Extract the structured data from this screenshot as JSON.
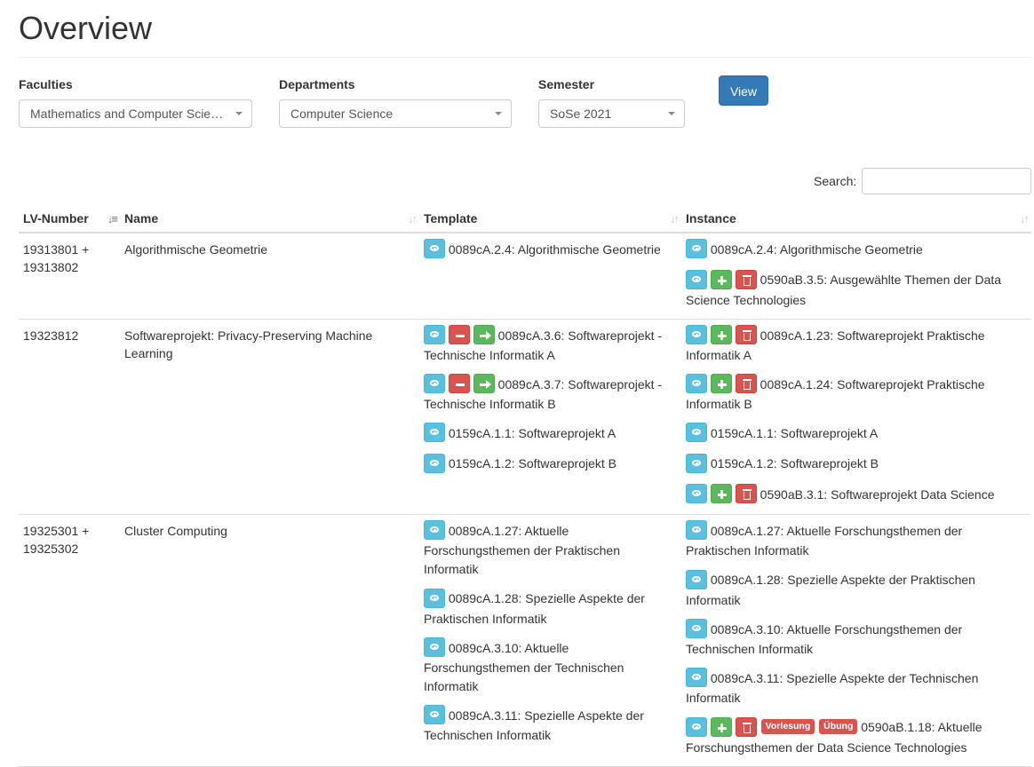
{
  "page": {
    "title": "Overview"
  },
  "filters": {
    "faculties": {
      "label": "Faculties",
      "value": "Mathematics and Computer Science"
    },
    "departments": {
      "label": "Departments",
      "value": "Computer Science"
    },
    "semester": {
      "label": "Semester",
      "value": "SoSe 2021"
    },
    "view_label": "View"
  },
  "search": {
    "label": "Search:",
    "value": ""
  },
  "table": {
    "headers": {
      "lv_number": "LV-Number",
      "name": "Name",
      "template": "Template",
      "instance": "Instance"
    },
    "rows": [
      {
        "lv": [
          "19313801 +",
          "19313802"
        ],
        "name": "Algorithmische Geometrie",
        "template": [
          {
            "buttons": [
              "view"
            ],
            "badges": [],
            "text": "0089cA.2.4: Algorithmische Geometrie"
          }
        ],
        "instance": [
          {
            "buttons": [
              "view"
            ],
            "badges": [],
            "text": "0089cA.2.4: Algorithmische Geometrie"
          },
          {
            "buttons": [
              "view",
              "add",
              "delete"
            ],
            "badges": [],
            "text": "0590aB.3.5: Ausgewählte Themen der Data Science Technologies"
          }
        ]
      },
      {
        "lv": [
          "19323812"
        ],
        "name": "Softwareprojekt: Privacy-Preserving Machine Learning",
        "template": [
          {
            "buttons": [
              "view",
              "remove",
              "forward"
            ],
            "badges": [],
            "text": "0089cA.3.6: Softwareprojekt - Technische Informatik A"
          },
          {
            "buttons": [
              "view",
              "remove",
              "forward"
            ],
            "badges": [],
            "text": "0089cA.3.7: Softwareprojekt - Technische Informatik B"
          },
          {
            "buttons": [
              "view"
            ],
            "badges": [],
            "text": "0159cA.1.1: Softwareprojekt A"
          },
          {
            "buttons": [
              "view"
            ],
            "badges": [],
            "text": "0159cA.1.2: Softwareprojekt B"
          }
        ],
        "instance": [
          {
            "buttons": [
              "view",
              "add",
              "delete"
            ],
            "badges": [],
            "text": "0089cA.1.23: Softwareprojekt Praktische Informatik A"
          },
          {
            "buttons": [
              "view",
              "add",
              "delete"
            ],
            "badges": [],
            "text": "0089cA.1.24: Softwareprojekt Praktische Informatik B"
          },
          {
            "buttons": [
              "view"
            ],
            "badges": [],
            "text": "0159cA.1.1: Softwareprojekt A"
          },
          {
            "buttons": [
              "view"
            ],
            "badges": [],
            "text": "0159cA.1.2: Softwareprojekt B"
          },
          {
            "buttons": [
              "view",
              "add",
              "delete"
            ],
            "badges": [],
            "text": "0590aB.3.1: Softwareprojekt Data Science"
          }
        ]
      },
      {
        "lv": [
          "19325301 +",
          "19325302"
        ],
        "name": "Cluster Computing",
        "template": [
          {
            "buttons": [
              "view"
            ],
            "badges": [],
            "text": "0089cA.1.27: Aktuelle Forschungsthemen der Praktischen Informatik"
          },
          {
            "buttons": [
              "view"
            ],
            "badges": [],
            "text": "0089cA.1.28: Spezielle Aspekte der Praktischen Informatik"
          },
          {
            "buttons": [
              "view"
            ],
            "badges": [],
            "text": "0089cA.3.10: Aktuelle Forschungsthemen der Technischen Informatik"
          },
          {
            "buttons": [
              "view"
            ],
            "badges": [],
            "text": "0089cA.3.11: Spezielle Aspekte der Technischen Informatik"
          }
        ],
        "instance": [
          {
            "buttons": [
              "view"
            ],
            "badges": [],
            "text": "0089cA.1.27: Aktuelle Forschungsthemen der Praktischen Informatik"
          },
          {
            "buttons": [
              "view"
            ],
            "badges": [],
            "text": "0089cA.1.28: Spezielle Aspekte der Praktischen Informatik"
          },
          {
            "buttons": [
              "view"
            ],
            "badges": [],
            "text": "0089cA.3.10: Aktuelle Forschungsthemen der Technischen Informatik"
          },
          {
            "buttons": [
              "view"
            ],
            "badges": [],
            "text": "0089cA.3.11: Spezielle Aspekte der Technischen Informatik"
          },
          {
            "buttons": [
              "view",
              "add",
              "delete"
            ],
            "badges": [
              "Vorlesung",
              "Übung"
            ],
            "text": "0590aB.1.18: Aktuelle Forschungsthemen der Data Science Technologies"
          }
        ]
      }
    ]
  },
  "colors": {
    "primary": "#337ab7",
    "info": "#5bc0de",
    "danger": "#d9534f",
    "success": "#5cb85c"
  }
}
